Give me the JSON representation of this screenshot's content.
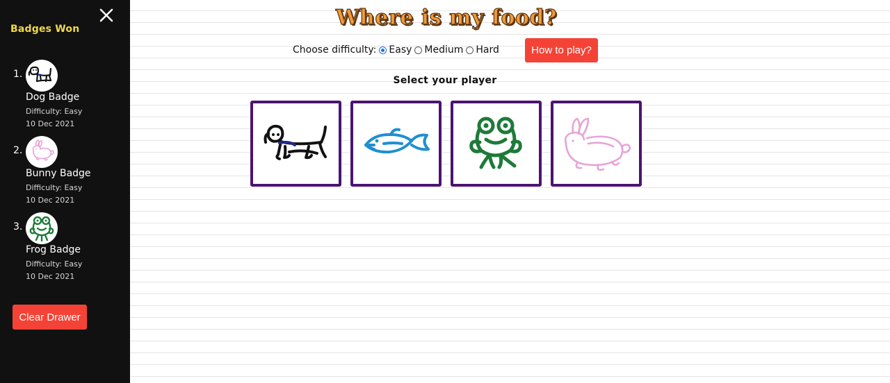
{
  "drawer": {
    "title": "Badges Won",
    "close_icon": "close-icon",
    "badges": [
      {
        "number": "1.",
        "icon": "dog-icon",
        "name": "Dog Badge",
        "difficulty": "Difficulty: Easy",
        "date": "10 Dec 2021"
      },
      {
        "number": "2.",
        "icon": "bunny-icon",
        "name": "Bunny Badge",
        "difficulty": "Difficulty: Easy",
        "date": "10 Dec 2021"
      },
      {
        "number": "3.",
        "icon": "frog-icon",
        "name": "Frog Badge",
        "difficulty": "Difficulty: Easy",
        "date": "10 Dec 2021"
      }
    ],
    "clear_label": "Clear Drawer"
  },
  "game": {
    "title": "Where is my food?",
    "difficulty_label": "Choose difficulty:",
    "difficulty_options": [
      {
        "label": "Easy",
        "selected": true
      },
      {
        "label": "Medium",
        "selected": false
      },
      {
        "label": "Hard",
        "selected": false
      }
    ],
    "howto_label": "How to play?",
    "select_heading": "Select your player",
    "players": [
      {
        "name": "dog",
        "icon": "dog-icon"
      },
      {
        "name": "fish",
        "icon": "fish-icon"
      },
      {
        "name": "frog",
        "icon": "frog-icon"
      },
      {
        "name": "bunny",
        "icon": "bunny-icon"
      }
    ]
  },
  "colors": {
    "drawer_bg": "#111111",
    "drawer_title": "#f2d84a",
    "button_red": "#f44336",
    "card_border": "#4a1470",
    "title_orange": "#f19a37",
    "dog": "#111111",
    "fish": "#1f8fd0",
    "frog": "#1e7a3a",
    "bunny": "#e7a3d8"
  }
}
